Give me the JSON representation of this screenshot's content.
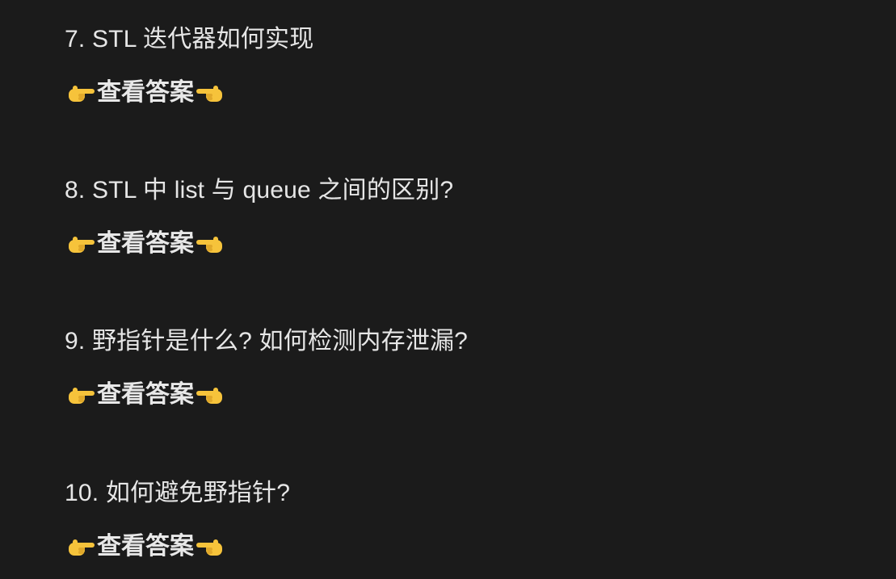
{
  "questions": [
    {
      "text": "7. STL 迭代器如何实现",
      "answer_label": "查看答案"
    },
    {
      "text": "8. STL 中 list 与 queue 之间的区别?",
      "answer_label": "查看答案"
    },
    {
      "text": "9. 野指针是什么? 如何检测内存泄漏?",
      "answer_label": "查看答案"
    },
    {
      "text": "10. 如何避免野指针?",
      "answer_label": "查看答案"
    }
  ],
  "icons": {
    "left": "pointing-right-hand-icon",
    "right": "pointing-left-hand-icon"
  },
  "colors": {
    "background": "#1b1b1b",
    "text": "#e6e6e6",
    "emoji": "#f6c33b"
  }
}
